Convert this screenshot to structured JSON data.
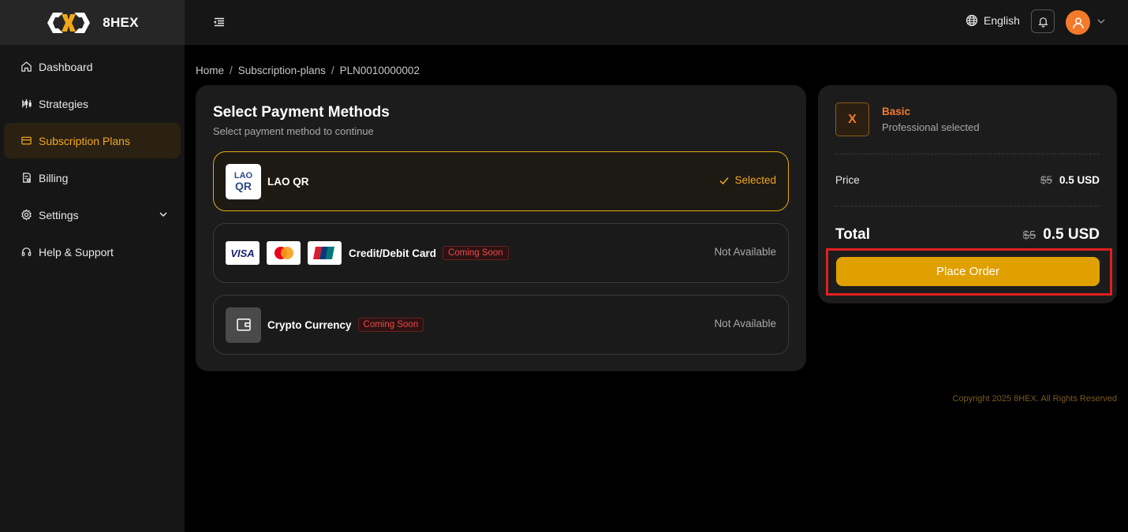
{
  "brand": {
    "name": "8HEX",
    "accent": "#f1a81a"
  },
  "sidebar": {
    "items": [
      {
        "label": "Dashboard",
        "icon": "home-icon",
        "active": false
      },
      {
        "label": "Strategies",
        "icon": "strategies-icon",
        "active": false
      },
      {
        "label": "Subscription Plans",
        "icon": "card-icon",
        "active": true
      },
      {
        "label": "Billing",
        "icon": "billing-icon",
        "active": false
      },
      {
        "label": "Settings",
        "icon": "gear-icon",
        "active": false,
        "expandable": true
      },
      {
        "label": "Help & Support",
        "icon": "headset-icon",
        "active": false
      }
    ]
  },
  "header": {
    "language": "English"
  },
  "breadcrumb": {
    "home": "Home",
    "section": "Subscription-plans",
    "current": "PLN0010000002"
  },
  "payment": {
    "title": "Select Payment Methods",
    "subtitle": "Select payment method to continue",
    "methods": [
      {
        "name": "LAO QR",
        "status": "Selected",
        "logo_l1": "LAO",
        "logo_l2": "QR"
      },
      {
        "name": "Credit/Debit Card",
        "badge": "Coming Soon",
        "status": "Not Available",
        "visa": "VISA"
      },
      {
        "name": "Crypto Currency",
        "badge": "Coming Soon",
        "status": "Not Available"
      }
    ]
  },
  "summary": {
    "plan_icon": "X",
    "plan_name": "Basic",
    "plan_desc": "Professional selected",
    "price_label": "Price",
    "price_old": "$5",
    "price_new": "0.5 USD",
    "total_label": "Total",
    "total_old": "$5",
    "total_new": "0.5 USD",
    "order_button": "Place Order"
  },
  "footer": {
    "copyright": "Copyright 2025 8HEX. All Rights Reserved"
  }
}
